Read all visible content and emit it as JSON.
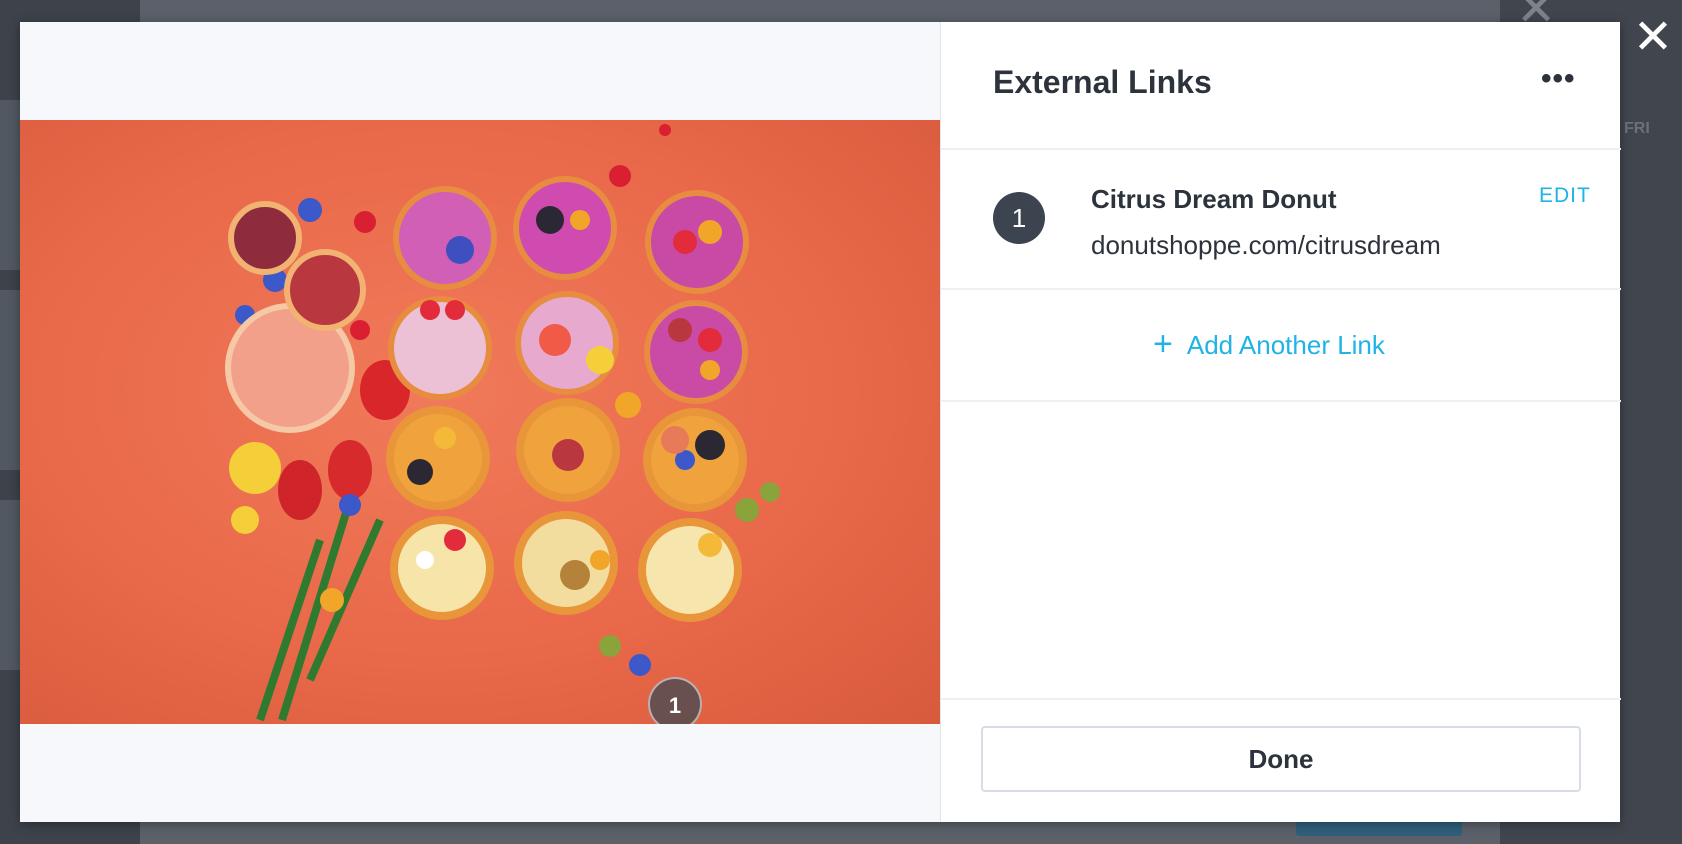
{
  "close_icon": "close-icon",
  "background": {
    "day_label": "FRI"
  },
  "panel": {
    "title": "External Links",
    "more_label": "•••",
    "links": [
      {
        "number": "1",
        "title": "Citrus Dream Donut",
        "url": "donutshoppe.com/citrusdream",
        "edit_label": "EDIT"
      }
    ],
    "add_plus": "+",
    "add_label": "Add Another Link",
    "done_label": "Done"
  },
  "image": {
    "hotspot_label": "1"
  },
  "colors": {
    "accent": "#1fb3e6",
    "text": "#2c333c",
    "photo_background": "#e9694a"
  }
}
